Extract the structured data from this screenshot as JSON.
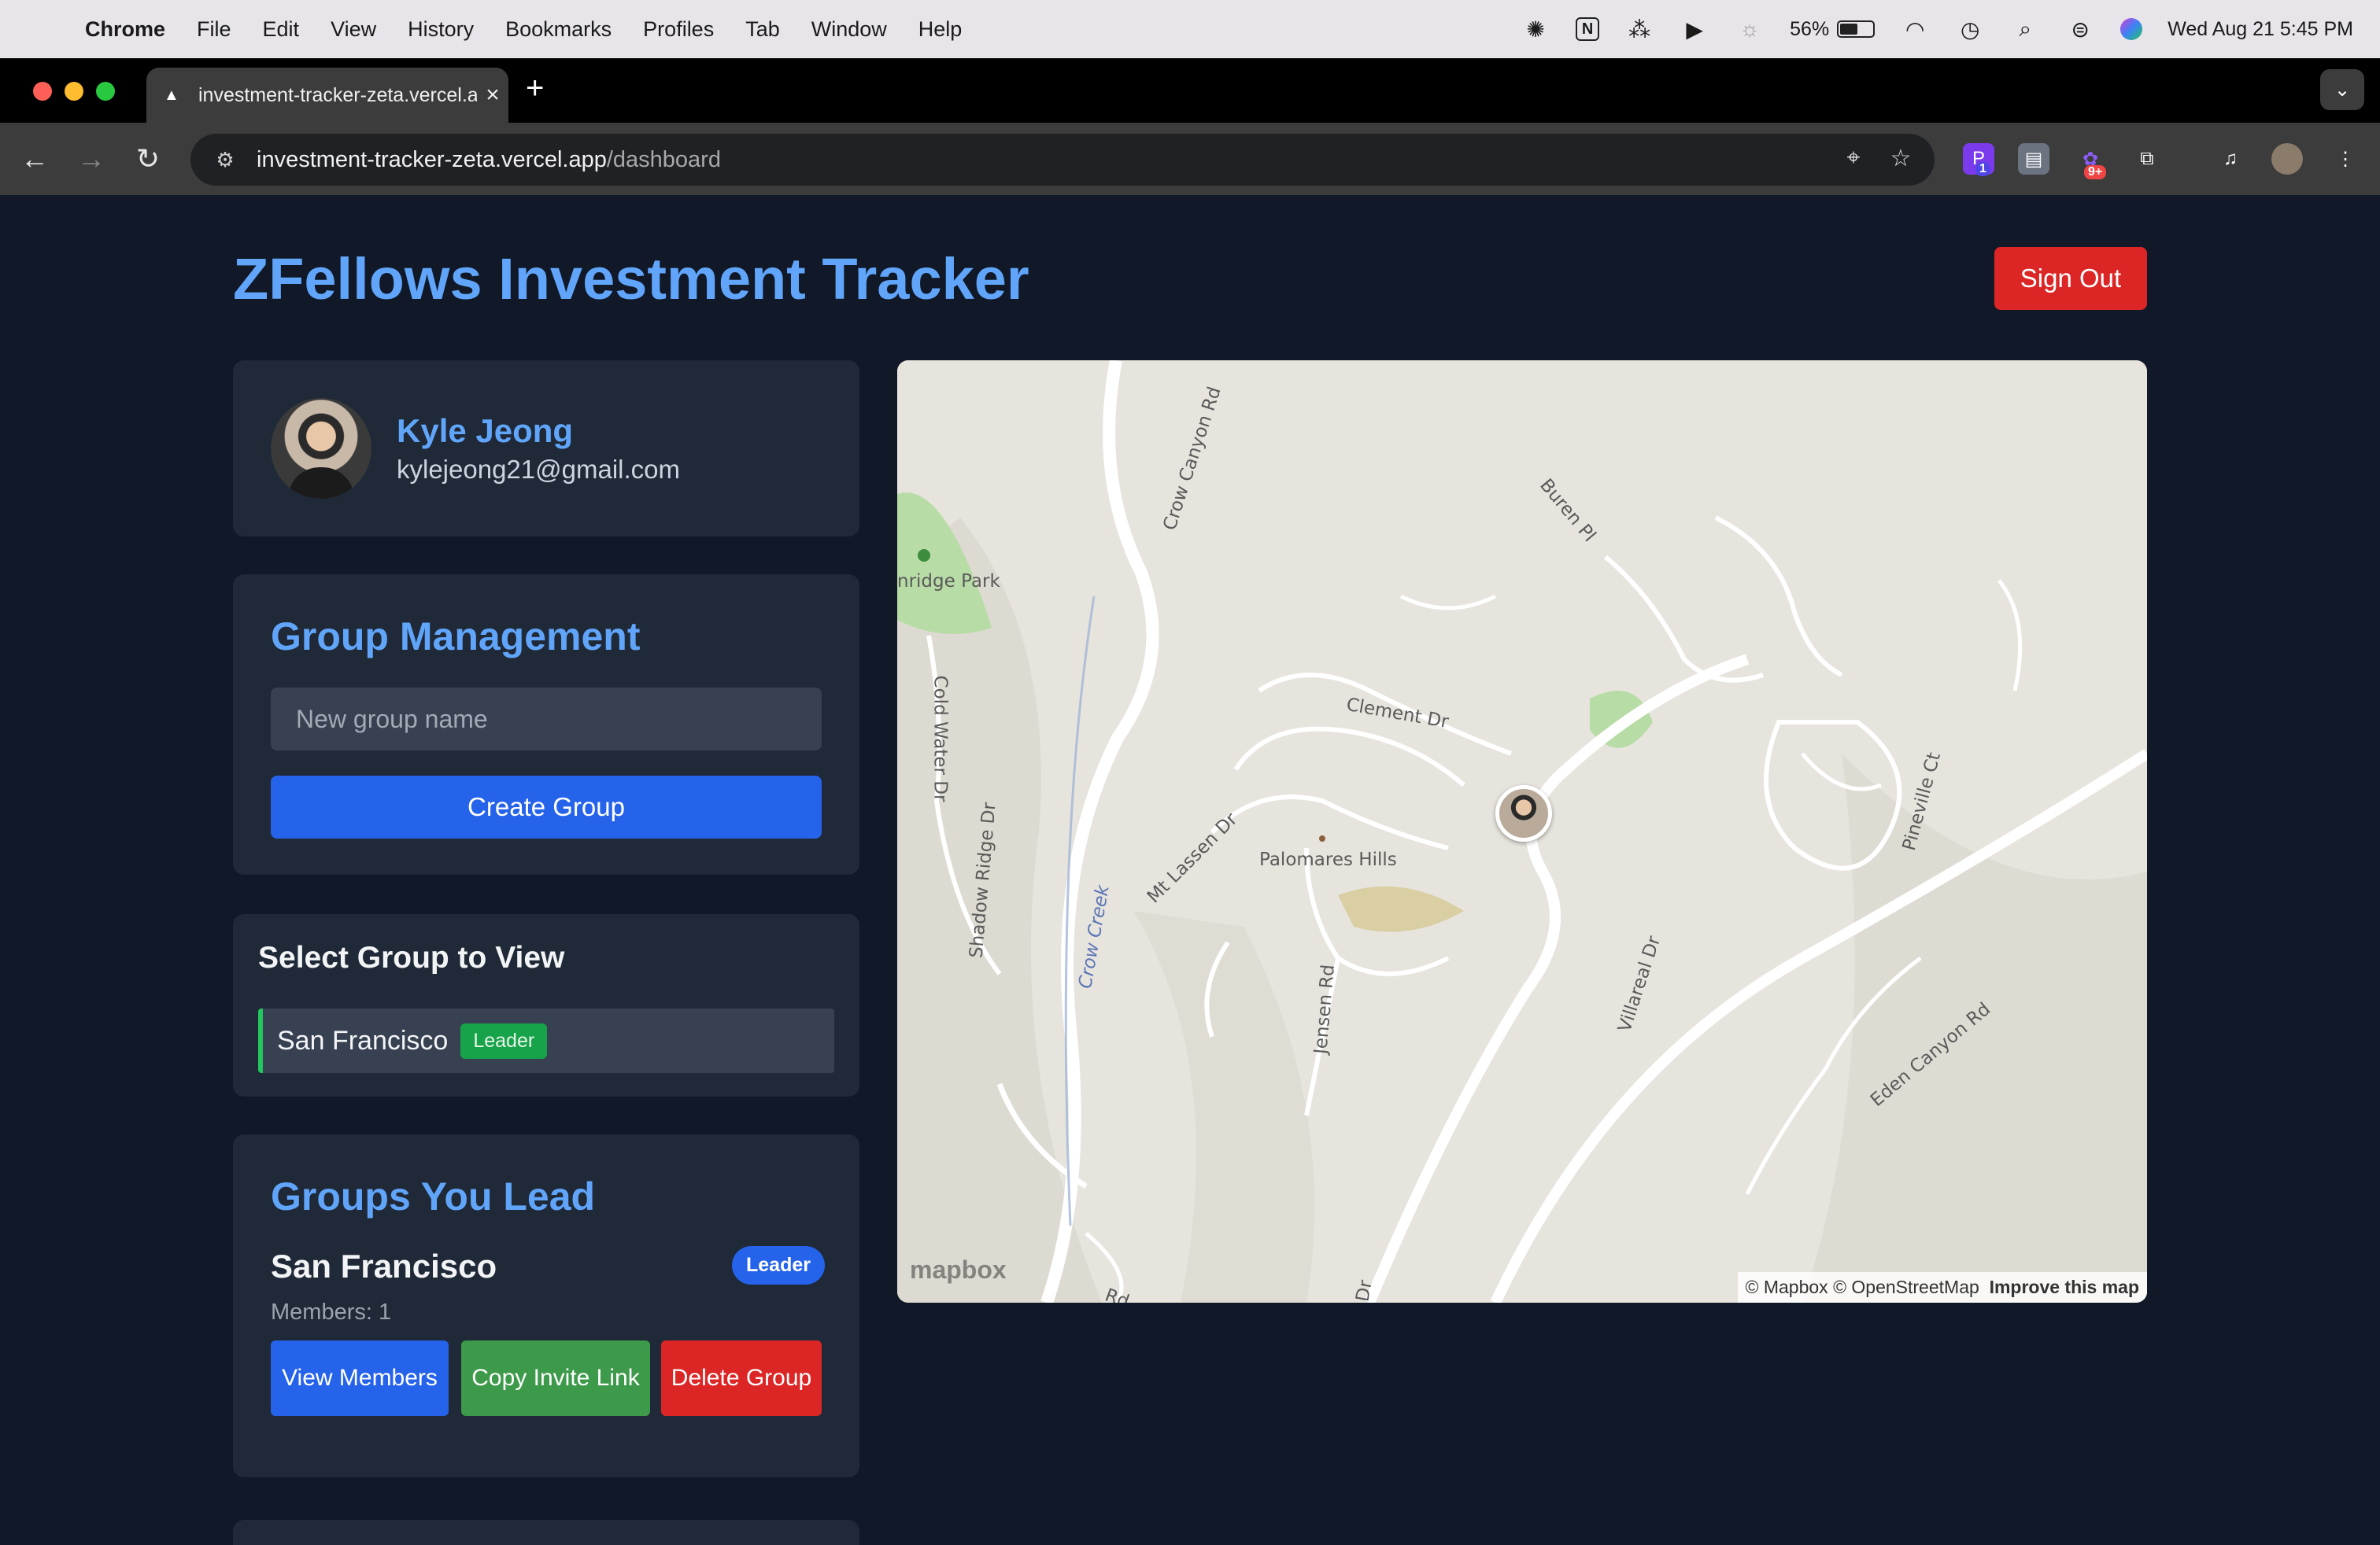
{
  "menubar": {
    "app": "Chrome",
    "items": [
      "File",
      "Edit",
      "View",
      "History",
      "Bookmarks",
      "Profiles",
      "Tab",
      "Window",
      "Help"
    ],
    "battery_percent": "56%",
    "battery_level": 0.56,
    "datetime": "Wed Aug 21  5:45 PM"
  },
  "browser": {
    "tab_title": "investment-tracker-zeta.vercel.app",
    "url_host": "investment-tracker-zeta.vercel.app",
    "url_path": "/dashboard",
    "ext_badge_1": "1",
    "ext_badge_2": "9+"
  },
  "header": {
    "title": "ZFellows Investment Tracker",
    "signout_label": "Sign Out"
  },
  "profile": {
    "name": "Kyle Jeong",
    "email": "kylejeong21@gmail.com"
  },
  "group_management": {
    "title": "Group Management",
    "input_placeholder": "New group name",
    "create_label": "Create Group"
  },
  "select_group": {
    "title": "Select Group to View",
    "items": [
      {
        "name": "San Francisco",
        "badge": "Leader"
      }
    ]
  },
  "groups_lead": {
    "title": "Groups You Lead",
    "groups": [
      {
        "name": "San Francisco",
        "badge": "Leader",
        "members": "Members: 1",
        "view_label": "View Members",
        "copy_label": "Copy Invite Link",
        "delete_label": "Delete Group"
      }
    ]
  },
  "map": {
    "labels": {
      "park": "nridge Park",
      "crow_canyon": "Crow Canyon Rd",
      "buren": "Buren Pl",
      "clement": "Clement Dr",
      "cold_water": "Cold Water Dr",
      "shadow_ridge": "Shadow Ridge Dr",
      "crow_creek": "Crow Creek",
      "mt_lassen": "Mt Lassen Dr",
      "palomares": "Palomares Hills",
      "jensen": "Jensen Rd",
      "villareal": "Villareal Dr",
      "pineville": "Pineville Ct",
      "eden_canyon": "Eden Canyon Rd",
      "rd_bottom": "Rd",
      "dr_bottom": "Dr"
    },
    "logo": "mapbox",
    "attribution": "© Mapbox © OpenStreetMap",
    "improve": "Improve this map"
  }
}
